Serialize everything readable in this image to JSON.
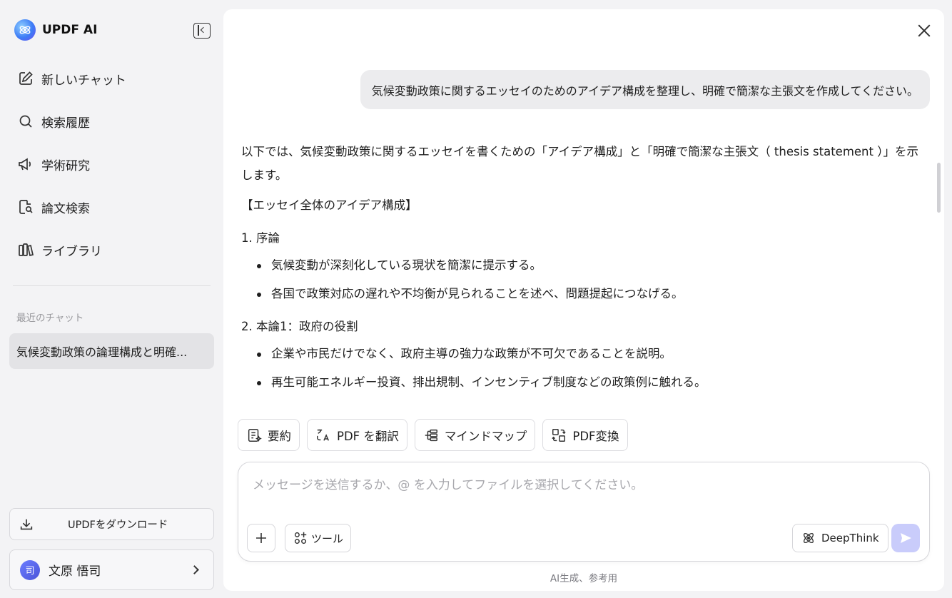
{
  "app": {
    "name": "UPDF AI"
  },
  "sidebar": {
    "nav": [
      {
        "label": "新しいチャット",
        "icon": "new-chat-icon"
      },
      {
        "label": "検索履歴",
        "icon": "search-icon"
      },
      {
        "label": "学術研究",
        "icon": "megaphone-icon"
      },
      {
        "label": "論文検索",
        "icon": "document-search-icon"
      },
      {
        "label": "ライブラリ",
        "icon": "library-icon"
      }
    ],
    "recent_label": "最近のチャット",
    "recent_items": [
      {
        "title": "気候変動政策の論理構成と明確..."
      }
    ],
    "download_label": "UPDFをダウンロード",
    "user": {
      "avatar_char": "司",
      "name": "文原 悟司"
    }
  },
  "chat": {
    "user_message": "気候変動政策に関するエッセイのためのアイデア構成を整理し、明確で簡潔な主張文を作成してください。",
    "answer": {
      "intro": "以下では、気候変動政策に関するエッセイを書くための「アイデア構成」と「明確で簡潔な主張文（ thesis statement ）」を示します。",
      "heading": "【エッセイ全体のアイデア構成】",
      "sections": [
        {
          "title": "1. 序論",
          "bullets": [
            "気候変動が深刻化している現状を簡潔に提示する。",
            "各国で政策対応の遅れや不均衡が見られることを述べ、問題提起につなげる。"
          ]
        },
        {
          "title": "2. 本論1：政府の役割",
          "bullets": [
            "企業や市民だけでなく、政府主導の強力な政策が不可欠であることを説明。",
            "再生可能エネルギー投資、排出規制、インセンティブ制度などの政策例に触れる。"
          ]
        }
      ]
    }
  },
  "quick_actions": [
    {
      "label": "要約",
      "icon": "summary-icon"
    },
    {
      "label": "PDF を翻訳",
      "icon": "translate-icon"
    },
    {
      "label": "マインドマップ",
      "icon": "mindmap-icon"
    },
    {
      "label": "PDF変換",
      "icon": "convert-icon"
    }
  ],
  "composer": {
    "placeholder": "メッセージを送信するか、@ を入力してファイルを選択してください。",
    "tools_label": "ツール",
    "deepthink_label": "DeepThink"
  },
  "footnote": "AI生成、参考用",
  "colors": {
    "accent": "#5b63f5",
    "send_disabled": "#c9ccfb"
  }
}
